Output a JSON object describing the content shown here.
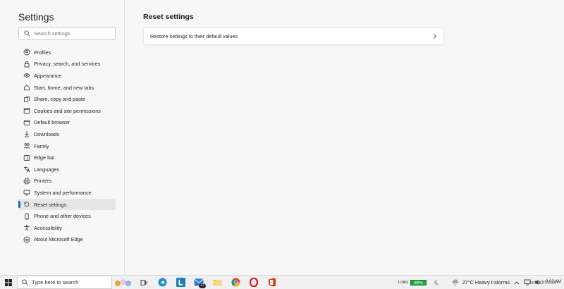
{
  "sidebar": {
    "title": "Settings",
    "search_placeholder": "Search settings",
    "items": [
      {
        "label": "Profiles",
        "icon": "profile-icon",
        "active": false
      },
      {
        "label": "Privacy, search, and services",
        "icon": "lock-icon",
        "active": false
      },
      {
        "label": "Appearance",
        "icon": "appearance-icon",
        "active": false
      },
      {
        "label": "Start, home, and new tabs",
        "icon": "home-icon",
        "active": false
      },
      {
        "label": "Share, copy and paste",
        "icon": "share-icon",
        "active": false
      },
      {
        "label": "Cookies and site permissions",
        "icon": "cookie-icon",
        "active": false
      },
      {
        "label": "Default browser",
        "icon": "browser-icon",
        "active": false
      },
      {
        "label": "Downloads",
        "icon": "download-icon",
        "active": false
      },
      {
        "label": "Family",
        "icon": "family-icon",
        "active": false
      },
      {
        "label": "Edge bar",
        "icon": "edge-bar-icon",
        "active": false
      },
      {
        "label": "Languages",
        "icon": "language-icon",
        "active": false
      },
      {
        "label": "Printers",
        "icon": "printer-icon",
        "active": false
      },
      {
        "label": "System and performance",
        "icon": "system-icon",
        "active": false
      },
      {
        "label": "Reset settings",
        "icon": "reset-icon",
        "active": true
      },
      {
        "label": "Phone and other devices",
        "icon": "phone-icon",
        "active": false
      },
      {
        "label": "Accessibility",
        "icon": "accessibility-icon",
        "active": false
      },
      {
        "label": "About Microsoft Edge",
        "icon": "edge-icon",
        "active": false
      }
    ]
  },
  "main": {
    "title": "Reset settings",
    "card_label": "Restore settings to their default values"
  },
  "taskbar": {
    "search_text": "Type here to search",
    "mail_badge": "27",
    "links_label": "Links",
    "battery": "99%",
    "weather": "27°C  Heavy t-storms",
    "time": "9:02 AM",
    "date": "",
    "watermark": "wsxdn.com"
  },
  "colors": {
    "accent": "#0f6cbd",
    "battery": "#1ba845"
  }
}
